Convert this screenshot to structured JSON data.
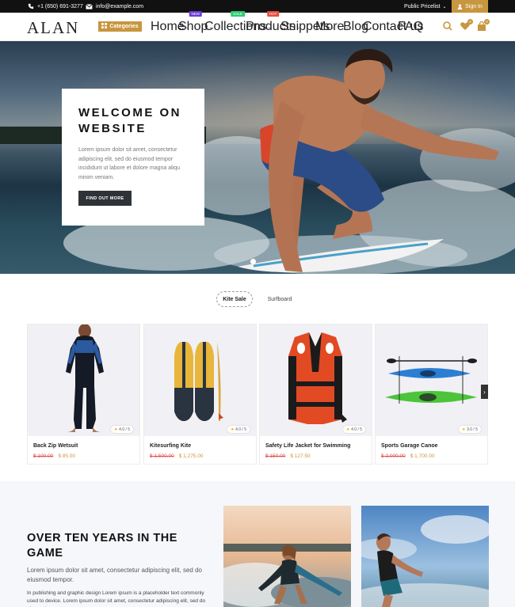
{
  "topbar": {
    "phone": "+1 (650) 691-3277",
    "email": "info@example.com",
    "pricelist": "Public Pricelist",
    "signin": "Sign In"
  },
  "header": {
    "logo": "ALAN",
    "categories": "Categories",
    "nav": [
      {
        "label": "Home",
        "dropdown": true
      },
      {
        "label": "Shop",
        "dropdown": true,
        "badge": "NEW",
        "badge_color": "#6a3bd8"
      },
      {
        "label": "Collections",
        "dropdown": true,
        "badge": "SALE",
        "badge_color": "#2ecc71"
      },
      {
        "label": "Products",
        "dropdown": true,
        "badge": "HOT",
        "badge_color": "#e74c3c"
      },
      {
        "label": "Snippets",
        "dropdown": true
      },
      {
        "label": "More",
        "dropdown": true
      },
      {
        "label": "Blog",
        "dropdown": false
      },
      {
        "label": "Contact us",
        "dropdown": false
      },
      {
        "label": "FAQ",
        "dropdown": false
      }
    ],
    "wishlist_count": "0",
    "cart_count": "0"
  },
  "hero": {
    "title": "WELCOME ON WEBSITE",
    "text": "Lorem ipsum dolor sit amet, consectetur adipiscing elit, sed do eiusmod tempor incididunt ut labore et dolore magna aliqu minim veniam.",
    "button": "FIND OUT MORE"
  },
  "tabs": {
    "active": "Kite Sale",
    "inactive": "Surfboard"
  },
  "products": [
    {
      "name": "Back Zip Wetsuit",
      "rating": "4.0 / 5",
      "old_price": "$ 100.00",
      "price": "$ 85.00"
    },
    {
      "name": "Kitesurfing Kite",
      "rating": "4.0 / 5",
      "old_price": "$ 1,500.00",
      "price": "$ 1,275.00"
    },
    {
      "name": "Safety Life Jacket for Swimming",
      "rating": "4.0 / 5",
      "old_price": "$ 150.00",
      "price": "$ 127.50"
    },
    {
      "name": "Sports Garage Canoe",
      "rating": "3.0 / 5",
      "old_price": "$ 2,000.00",
      "price": "$ 1,700.00"
    }
  ],
  "about": {
    "title": "OVER TEN YEARS IN THE GAME",
    "lead": "Lorem ipsum dolor sit amet, consectetur adipiscing elit, sed do eiusmod tempor.",
    "body": "In publishing and graphic design Lorem ipsum is a placeholder text commonly used to device. Lorem ipsum dolor sit amet, consectetur adipiscing elit, sed do eiusmod"
  },
  "colors": {
    "accent": "#c8963e",
    "old_price": "#e05050",
    "dark_button": "#2f3337"
  }
}
